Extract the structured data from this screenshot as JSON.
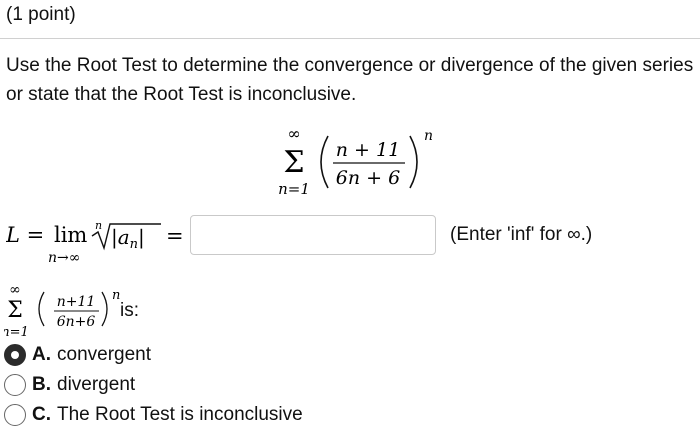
{
  "header": {
    "points": "(1 point)"
  },
  "prompt": "Use the Root Test to determine the convergence or divergence of the given series or state that the Root Test is inconclusive.",
  "series": {
    "sum_symbol": "Σ",
    "upper": "∞",
    "lower": "n=1",
    "numerator": "n + 11",
    "denominator": "6n + 6",
    "exponent": "n",
    "numerator_small": "n+11",
    "denominator_small": "6n+6"
  },
  "limit": {
    "lhs": "L =",
    "lim": "lim",
    "sub": "n→∞",
    "root_index": "n",
    "radicand": "|a",
    "radicand_sub": "n",
    "radicand_end": "|",
    "equals": "=",
    "input_value": "",
    "hint": "(Enter 'inf' for ∞.)"
  },
  "question": {
    "is_text": "is:"
  },
  "options": [
    {
      "letter": "A.",
      "text": "convergent",
      "selected": true
    },
    {
      "letter": "B.",
      "text": "divergent",
      "selected": false
    },
    {
      "letter": "C.",
      "text": "The Root Test is inconclusive",
      "selected": false
    }
  ]
}
